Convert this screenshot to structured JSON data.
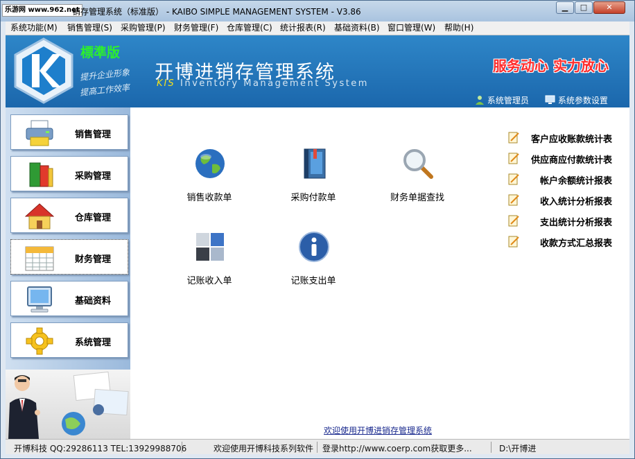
{
  "window": {
    "title_logo": "乐游网 www.962.net",
    "title": "销存管理系统（标准版） - KAIBO SIMPLE MANAGEMENT SYSTEM - V3.86",
    "minimize": "▁",
    "maximize": "□",
    "close": "✕"
  },
  "menu": [
    "系统功能(M)",
    "销售管理(S)",
    "采购管理(P)",
    "财务管理(F)",
    "仓库管理(C)",
    "统计报表(R)",
    "基础资料(B)",
    "窗口管理(W)",
    "帮助(H)"
  ],
  "header": {
    "edition": "標準版",
    "slogan1": "提升企业形象",
    "slogan2": "提高工作效率",
    "title": "开博进销存管理系统",
    "subtitle_kis": "KIS",
    "subtitle_rest": "Inventory Management System",
    "motto": "服务动心  实力放心",
    "user_link": "系统管理员",
    "settings_link": "系统参数设置"
  },
  "sidebar": [
    {
      "label": "销售管理",
      "icon": "printer-icon"
    },
    {
      "label": "采购管理",
      "icon": "books-icon"
    },
    {
      "label": "仓库管理",
      "icon": "house-icon"
    },
    {
      "label": "财务管理",
      "icon": "calendar-icon"
    },
    {
      "label": "基础资料",
      "icon": "monitor-icon"
    },
    {
      "label": "系统管理",
      "icon": "gear-icon"
    }
  ],
  "tiles": [
    {
      "label": "销售收款单",
      "icon": "globe-icon"
    },
    {
      "label": "采购付款单",
      "icon": "book-icon"
    },
    {
      "label": "财务单据查找",
      "icon": "magnifier-icon"
    },
    {
      "label": "记账收入单",
      "icon": "windows-icon"
    },
    {
      "label": "记账支出单",
      "icon": "info-icon"
    }
  ],
  "reports": [
    "客户应收账款统计表",
    "供应商应付款统计表",
    "帐户余额统计报表",
    "收入统计分析报表",
    "支出统计分析报表",
    "收款方式汇总报表"
  ],
  "welcome": "欢迎使用开博进销存管理系统",
  "status": {
    "company": "开博科技 QQ:29286113 TEL:13929988706",
    "message": "欢迎使用开博科技系列软件",
    "website": "登录http://www.coerp.com获取更多...",
    "path": "D:\\开博进"
  },
  "colors": {
    "header_blue": "#1b67ac",
    "motto_red": "#ff2c2c",
    "edition_green": "#2cf02c",
    "welcome_blue": "#1a2a8e"
  }
}
